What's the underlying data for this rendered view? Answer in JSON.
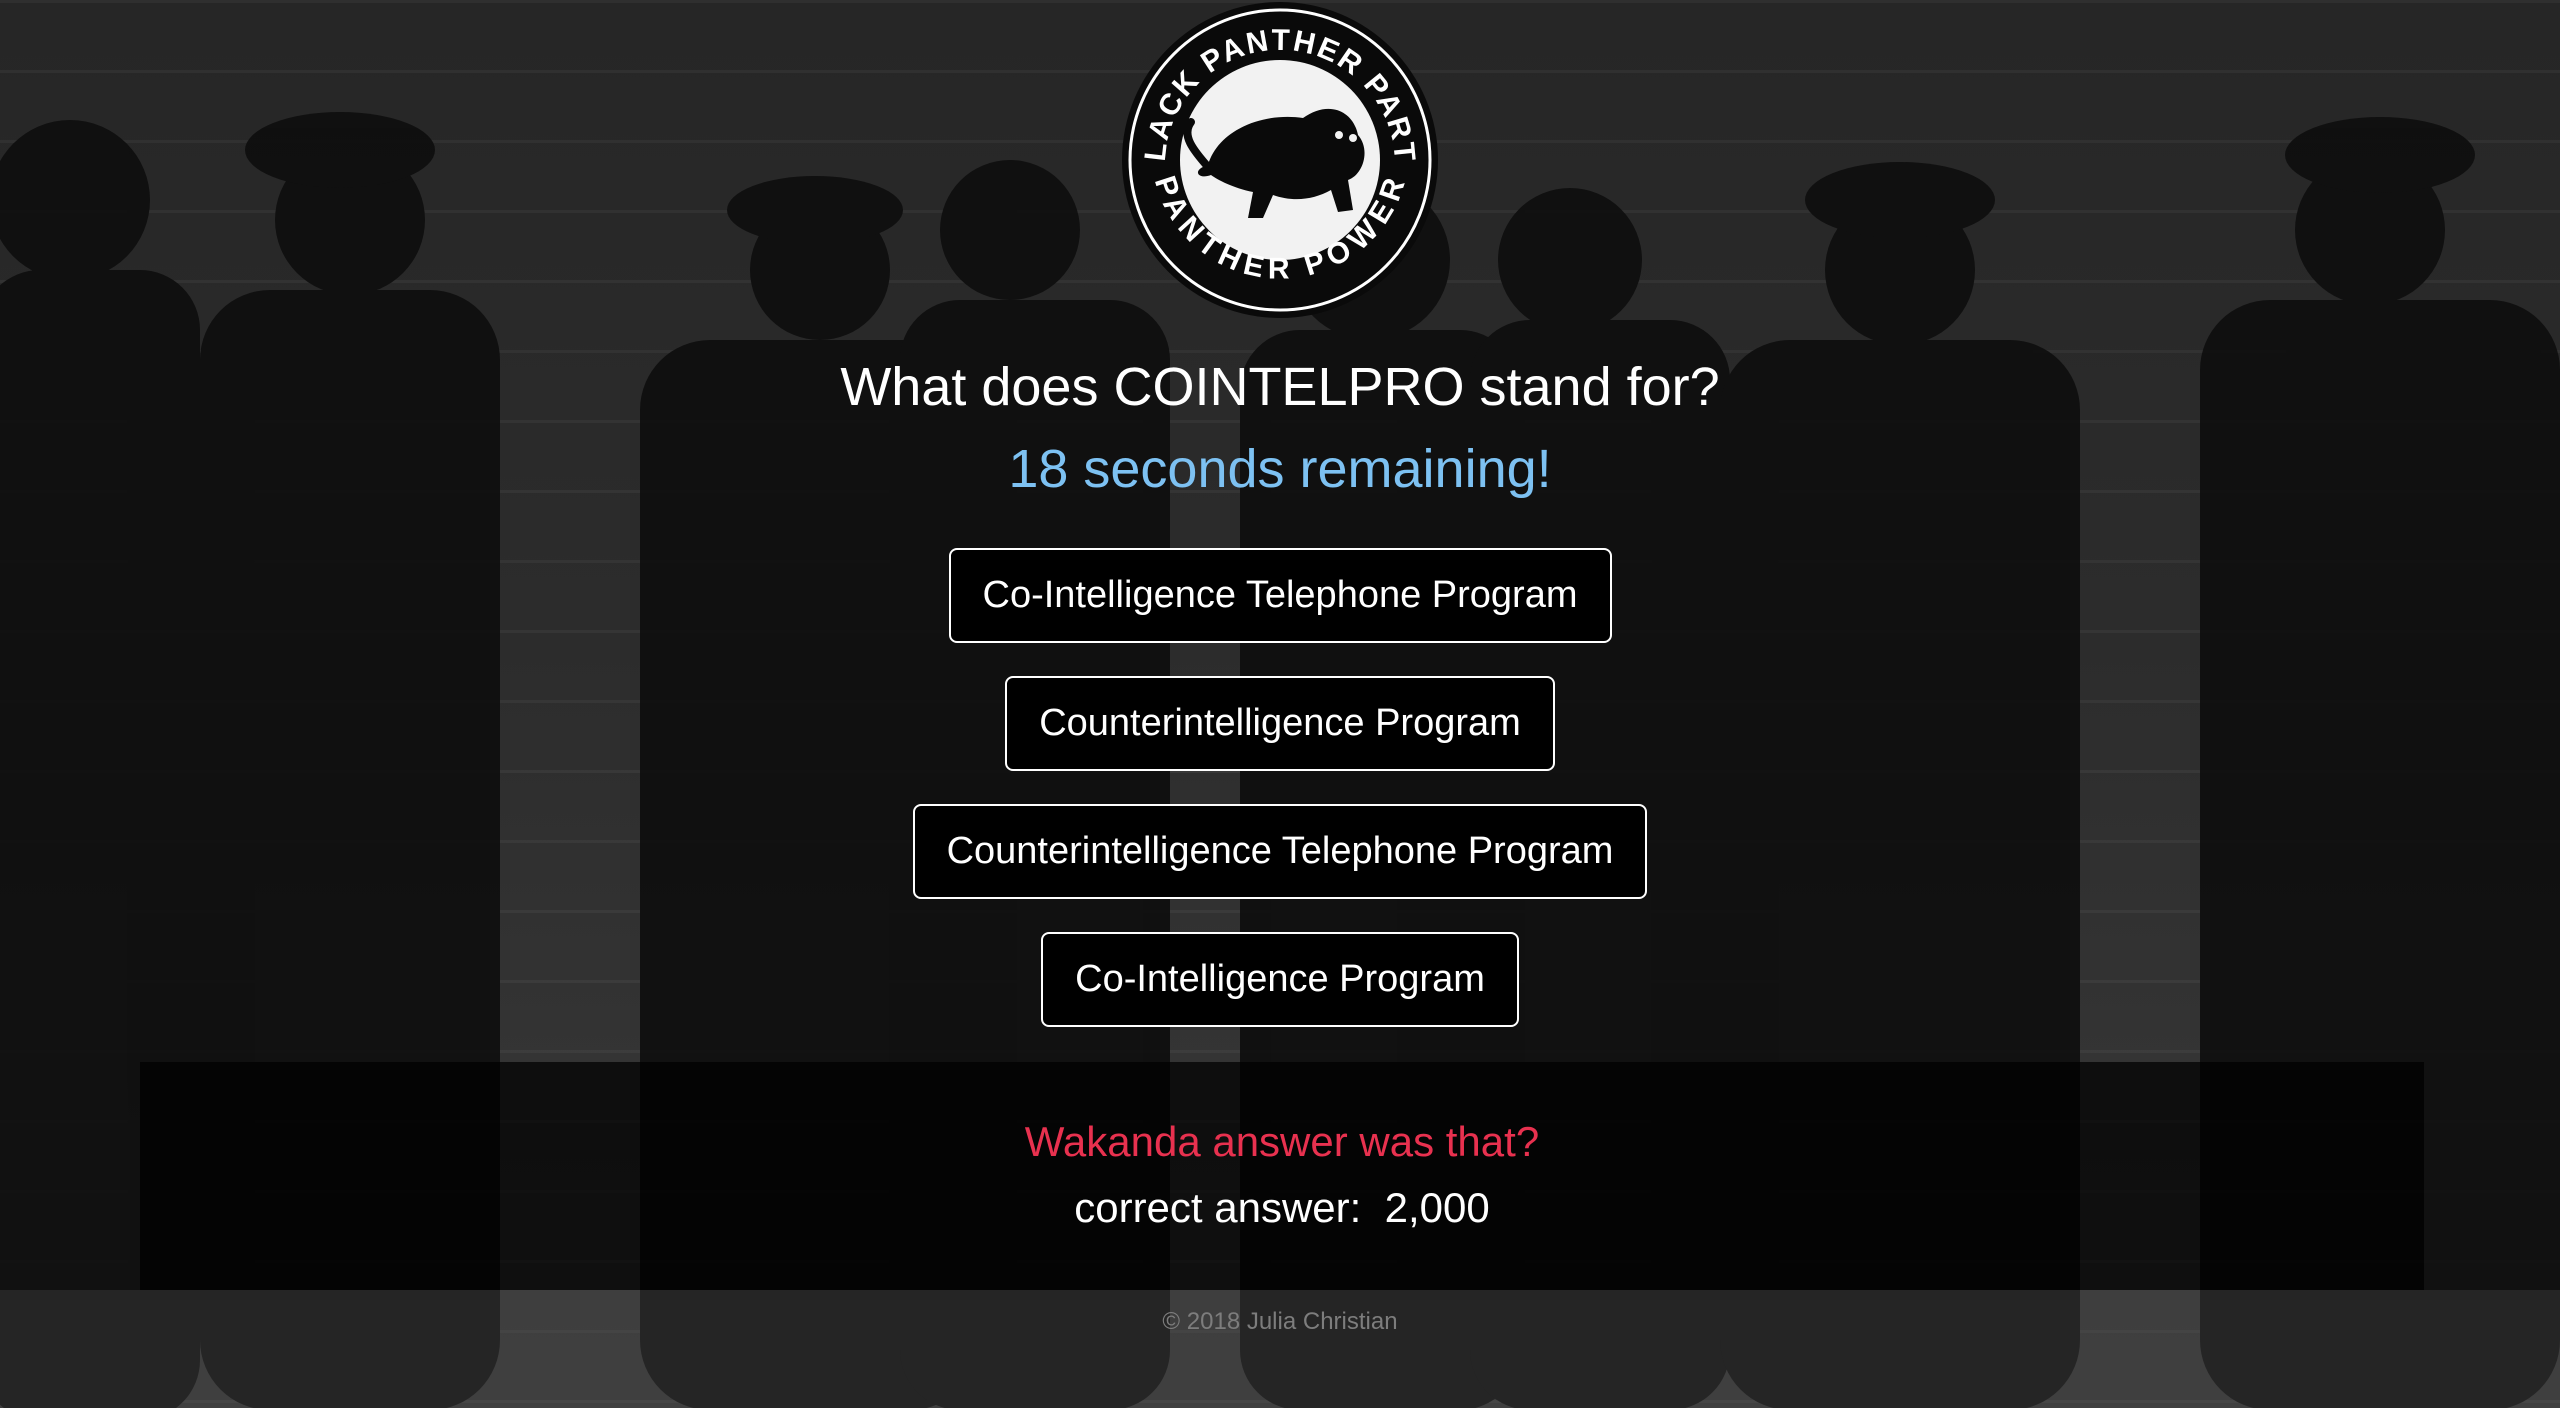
{
  "logo": {
    "top_text": "BLACK PANTHER PARTY",
    "bottom_text": "PANTHER POWER"
  },
  "quiz": {
    "question": "What does COINTELPRO stand for?",
    "timer_text": "18 seconds remaining!",
    "answers": [
      "Co-Intelligence Telephone Program",
      "Counterintelligence Program",
      "Counterintelligence Telephone Program",
      "Co-Intelligence Program"
    ]
  },
  "result": {
    "title": "Wakanda answer was that?",
    "label": "correct answer:",
    "value": "2,000"
  },
  "footer": {
    "text": "© 2018 Julia Christian"
  },
  "colors": {
    "timer": "#7dc1f2",
    "result_title": "#e8314f",
    "button_border": "#ffffff",
    "button_bg": "#000000"
  }
}
